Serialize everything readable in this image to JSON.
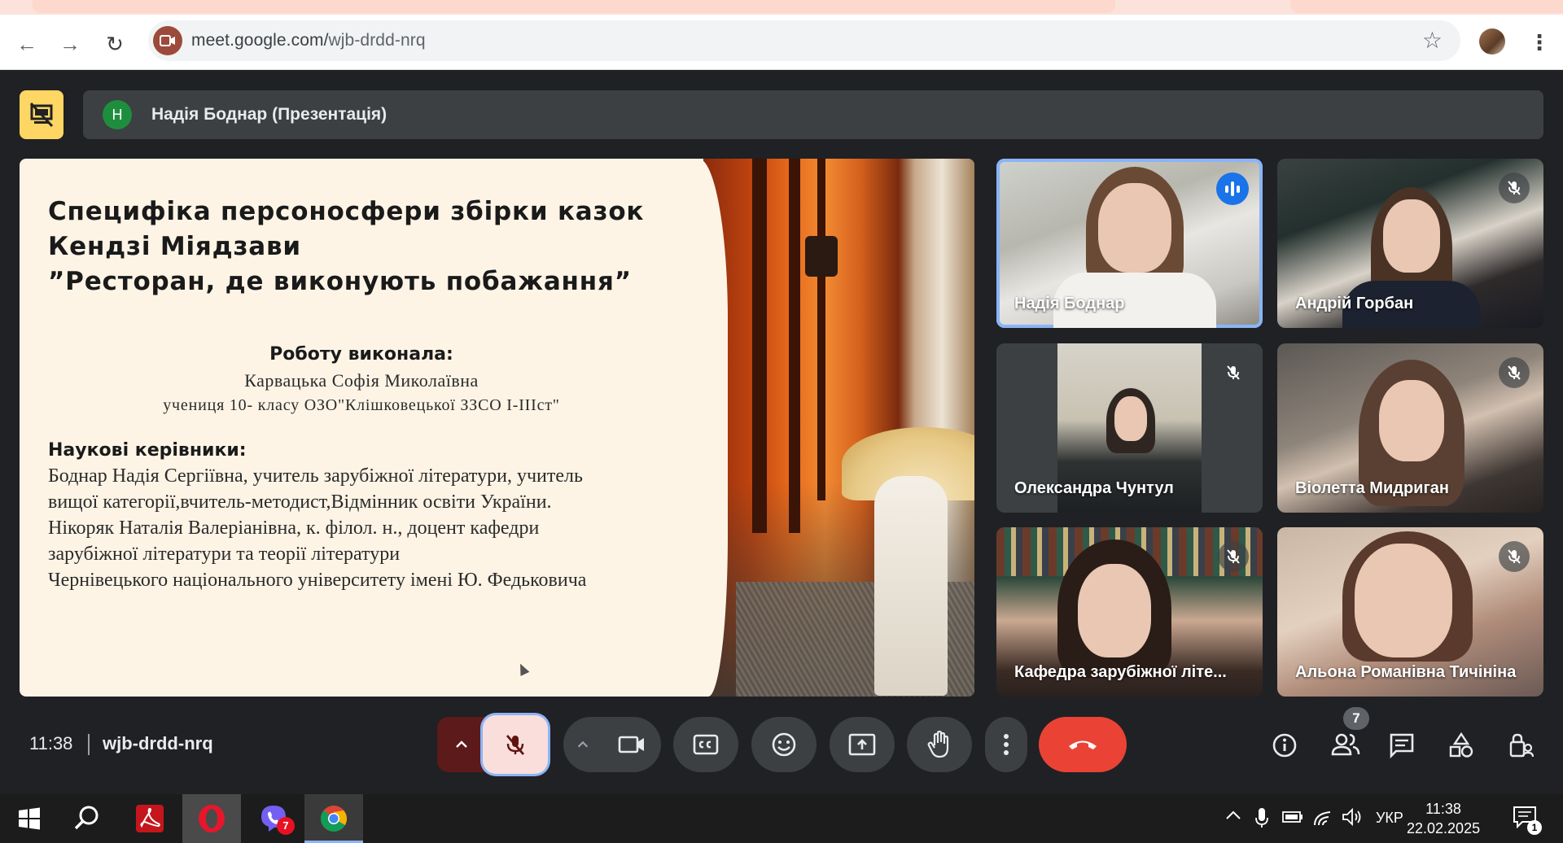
{
  "browser": {
    "url_host": "meet.google.com/",
    "url_path": "wjb-drdd-nrq",
    "back_icon": "←",
    "forward_icon": "→",
    "reload_icon": "↻",
    "star_icon": "☆",
    "menu_icon": "⋮"
  },
  "presenter": {
    "avatar_letter": "Н",
    "label": "Надія Боднар (Презентація)"
  },
  "slide": {
    "title_lines": [
      "Специфіка персоносфери збірки казок",
      "Кендзі Міядзави",
      "”Ресторан, де виконують побажання”"
    ],
    "author_heading": "Роботу виконала:",
    "author_name": "Карвацька Софія Миколаївна",
    "author_school": "учениця 10- класу ОЗО\"Клішковецької ЗЗСО І-ІІІст\"",
    "supervisors_heading": "Наукові керівники:",
    "supervisors_lines": [
      "Боднар Надія Сергіївна, учитель зарубіжної літератури, учитель",
      "вищої категорії,вчитель-методист,Відмінник освіти України.",
      "Нікоряк Наталія Валеріанівна, к. філол. н., доцент кафедри",
      "зарубіжної літератури та теорії літератури",
      "Чернівецького національного університету імені Ю. Федьковича"
    ]
  },
  "participants": [
    {
      "name": "Надія Боднар",
      "status": "speaking"
    },
    {
      "name": "Андрій Горбан",
      "status": "muted"
    },
    {
      "name": "Олександра Чунтул",
      "status": "muted"
    },
    {
      "name": "Віолетта Мидриган",
      "status": "muted"
    },
    {
      "name": "Кафедра зарубіжної літе...",
      "status": "muted"
    },
    {
      "name": "Альона Романівна Тичініна",
      "status": "muted"
    }
  ],
  "meeting": {
    "time": "11:38",
    "code": "wjb-drdd-nrq",
    "people_count": "7"
  },
  "taskbar": {
    "chrome_badge": "7",
    "language": "УКР",
    "time": "11:38",
    "date": "22.02.2025",
    "notifications": "1"
  },
  "colors": {
    "end_call": "#ea4335",
    "active_speaker": "#8ab4f8",
    "presenting": "#fdd663",
    "mic_muted_bg": "#f9dedc"
  }
}
